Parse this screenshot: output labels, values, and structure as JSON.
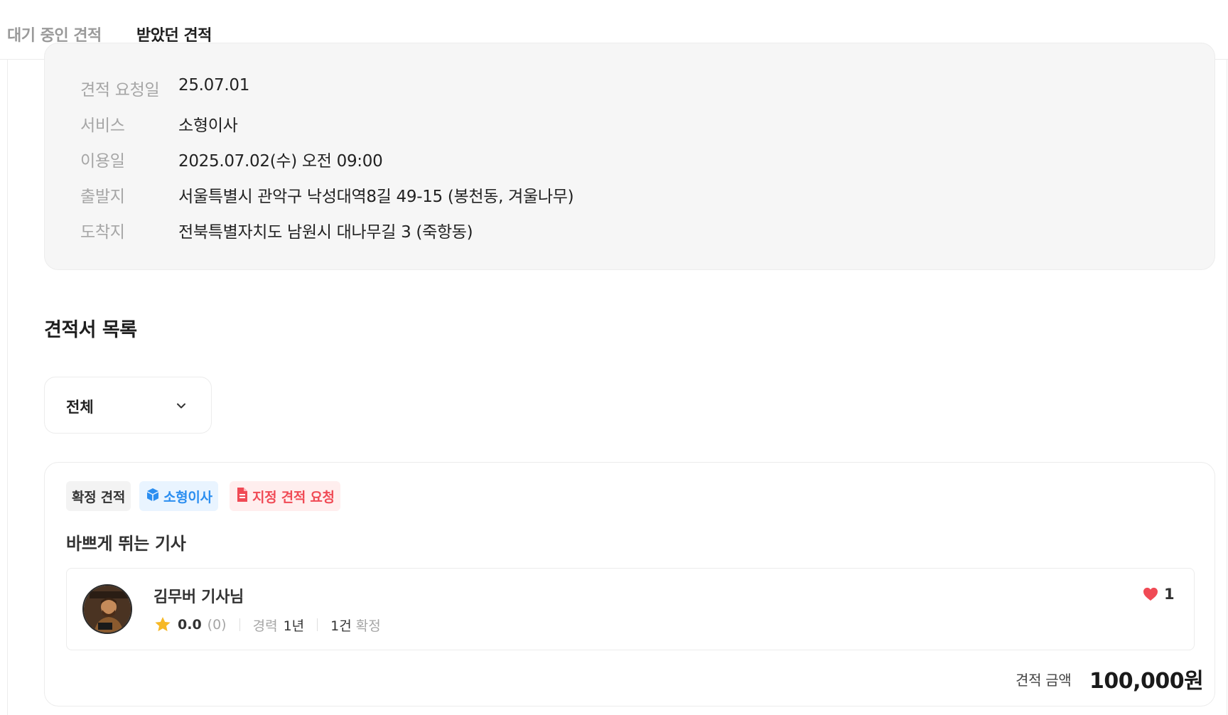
{
  "tabs": [
    {
      "label": "대기 중인 견적",
      "active": false
    },
    {
      "label": "받았던 견적",
      "active": true
    }
  ],
  "request_info": {
    "rows": [
      {
        "label": "견적 요청일",
        "value": "25.07.01"
      },
      {
        "label": "서비스",
        "value": "소형이사"
      },
      {
        "label": "이용일",
        "value": "2025.07.02(수) 오전 09:00"
      },
      {
        "label": "출발지",
        "value": "서울특별시 관악구 낙성대역8길 49-15 (봉천동, 겨울나무)"
      },
      {
        "label": "도착지",
        "value": "전북특별자치도 남원시 대나무길 3 (죽항동)"
      }
    ]
  },
  "list": {
    "title": "견적서 목록",
    "filter": {
      "selected": "전체"
    }
  },
  "quote": {
    "chips": {
      "confirm": "확정 견적",
      "service": "소형이사",
      "request": "지정 견적 요청"
    },
    "title": "바쁘게 뛰는 기사",
    "driver": {
      "name": "김무버 기사님",
      "rating": "0.0",
      "review_count": "(0)",
      "career_label": "경력",
      "career_value": "1년",
      "confirmed_value": "1건",
      "confirmed_label": "확정",
      "likes": "1"
    },
    "price_label": "견적 금액",
    "price_value": "100,000원"
  },
  "colors": {
    "accent_blue": "#2b8ef0",
    "accent_red": "#f04a55",
    "star": "#f6b826",
    "heart": "#f04a55",
    "card_bg": "#f6f6f6"
  },
  "icons": {
    "chevron": "chevron-down-icon",
    "service": "box-icon",
    "request": "document-icon",
    "star": "star-icon",
    "heart": "heart-icon"
  }
}
